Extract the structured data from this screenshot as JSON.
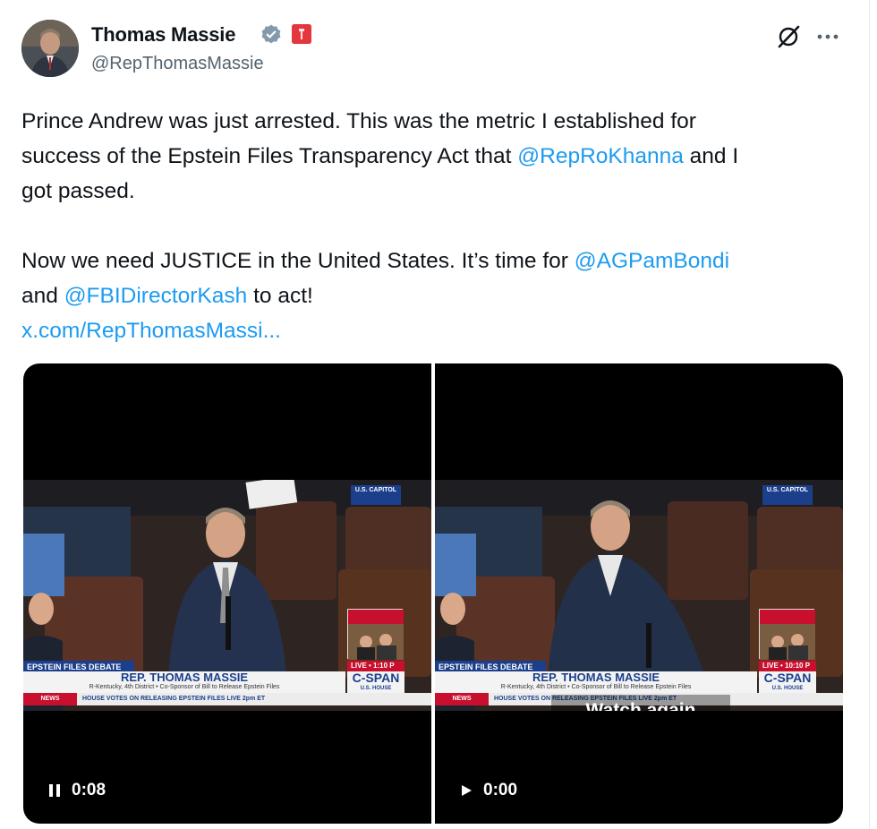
{
  "tweet": {
    "author_name": "Thomas Massie",
    "handle": "@RepThomasMassie",
    "text_line1": "Prince Andrew was just arrested. This was the metric I established for",
    "text_line2_a": "success of the Epstein Files Transparency Act that ",
    "text_line2_mention": "@RepRoKhanna",
    "text_line2_b": " and I",
    "text_line3": "got passed.",
    "text_line4_a": "Now we need JUSTICE in the United States. It’s time for ",
    "text_line4_mention": "@AGPamBondi",
    "text_line5_a": "and ",
    "text_line5_mention": "@FBIDirectorKash",
    "text_line5_b": " to act!",
    "link": "x.com/RepThomasMassi..."
  },
  "videos": [
    {
      "time": "0:08",
      "state_icon": "pause-icon",
      "chyron_top": "EPSTEIN FILES DEBATE RULES",
      "chyron_name": "REP. THOMAS MASSIE",
      "chyron_sub": "R-Kentucky, 4th District  •  Co-Sponsor of Bill to Release Epstein Files",
      "news_tag": "NEWS",
      "news_text": "HOUSE VOTES ON RELEASING EPSTEIN FILES  LIVE 2pm ET",
      "network": "C-SPAN",
      "network_sub": "U.S. HOUSE",
      "live": "LIVE  •  1:10 P",
      "location": "U.S. CAPITOL"
    },
    {
      "time": "0:00",
      "state_icon": "play-icon",
      "overlay": "Watch again",
      "chyron_top": "EPSTEIN FILES DEBATE RULES",
      "chyron_name": "REP. THOMAS MASSIE",
      "chyron_sub": "R-Kentucky, 4th District  •  Co-Sponsor of Bill to Release Epstein Files",
      "news_tag": "NEWS",
      "news_text": "HOUSE VOTES ON RELEASING EPSTEIN FILES  LIVE 2pm ET",
      "network": "C-SPAN",
      "network_sub": "U.S. HOUSE",
      "live": "LIVE  •  10:10 P",
      "location": "U.S. CAPITOL"
    }
  ],
  "colors": {
    "link": "#1d9bf0",
    "verified": "#829aab",
    "flag": "#e4363f",
    "cspan_blue": "#1c3f8c",
    "cspan_red": "#c8102e"
  }
}
